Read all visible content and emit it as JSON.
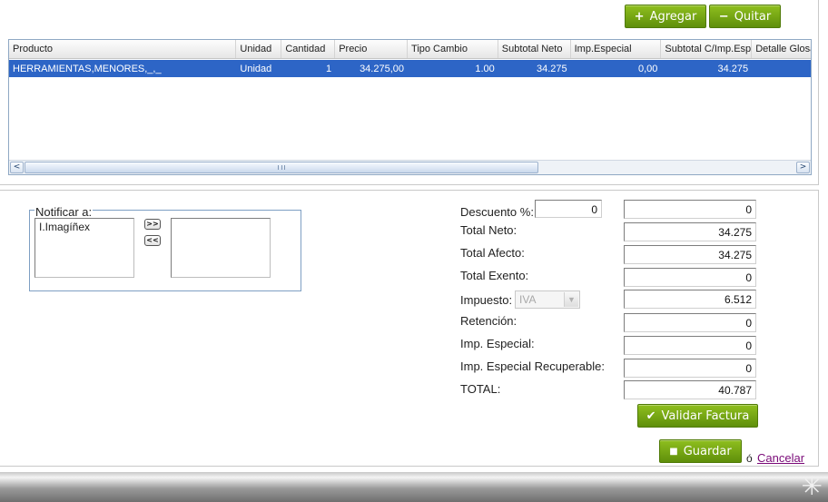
{
  "toolbar": {
    "add_label": "Agregar",
    "remove_label": "Quitar"
  },
  "grid": {
    "columns": [
      "Producto",
      "Unidad",
      "Cantidad",
      "Precio",
      "Tipo Cambio",
      "Subtotal Neto",
      "Imp.Especial",
      "Subtotal C/Imp.Esp",
      "Detalle Glosa"
    ],
    "rows": [
      [
        "HERRAMIENTAS,MENORES,_,_",
        "Unidad",
        "1",
        "34.275,00",
        "1.00",
        "34.275",
        "0,00",
        "34.275",
        ""
      ]
    ],
    "scroll_left": "<",
    "scroll_right": ">"
  },
  "notify": {
    "legend": "Notificar a:",
    "available": [
      "I.Imagíñex"
    ],
    "selected": [],
    "add_label": ">>",
    "remove_label": "<<"
  },
  "totals": {
    "descuento_label": "Descuento %:",
    "descuento_pct": "0",
    "descuento_value": "0",
    "neto_label": "Total Neto:",
    "neto_value": "34.275",
    "afecto_label": "Total Afecto:",
    "afecto_value": "34.275",
    "exento_label": "Total Exento:",
    "exento_value": "0",
    "impuesto_label": "Impuesto:",
    "impuesto_select": "IVA",
    "impuesto_value": "6.512",
    "retencion_label": "Retención:",
    "retencion_value": "0",
    "imp_especial_label": "Imp. Especial:",
    "imp_especial_value": "0",
    "imp_recuperable_label": "Imp. Especial Recuperable:",
    "imp_recuperable_value": "0",
    "total_label": "TOTAL:",
    "total_value": "40.787"
  },
  "actions": {
    "validate_label": "Validar Factura",
    "save_label": "Guardar",
    "or_text": "ó",
    "cancel_label": "Cancelar"
  },
  "colors": {
    "accent_green": "#6f9f12",
    "selection_blue": "#2d65c6",
    "cancel_link": "#7a0a78"
  },
  "icons": {
    "add": "plus-icon",
    "remove": "minus-icon",
    "validate": "check-icon",
    "save": "floppy-icon"
  }
}
